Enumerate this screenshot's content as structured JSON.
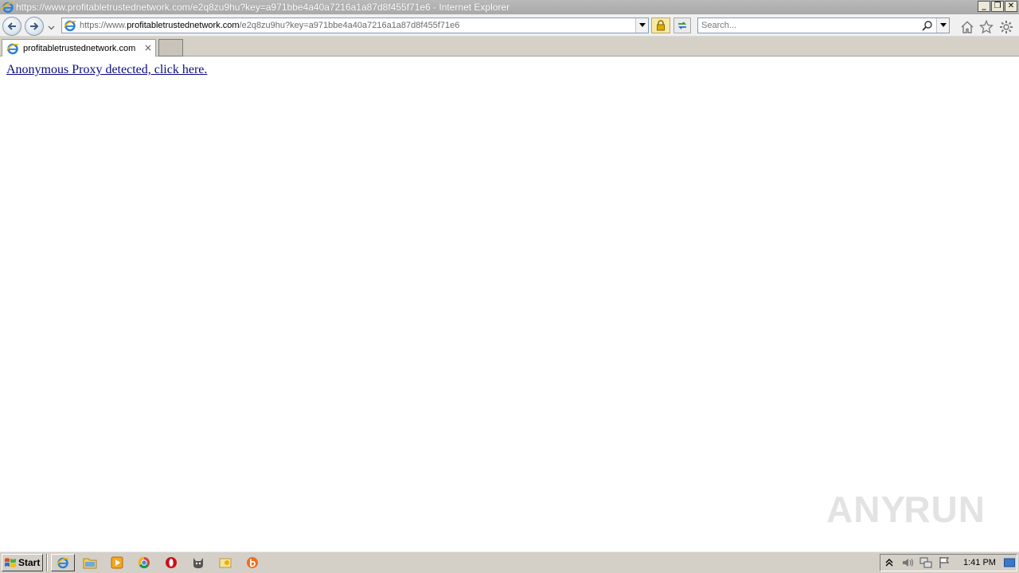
{
  "window": {
    "title": "https://www.profitabletrustednetwork.com/e2q8zu9hu?key=a971bbe4a40a7216a1a87d8f455f71e6 - Internet Explorer",
    "controls": {
      "minimize": "_",
      "restore": "❐",
      "close": "✕"
    }
  },
  "navbar": {
    "url_prefix": "https://www.",
    "url_domain": "profitabletrustednetwork.com",
    "url_path": "/e2q8zu9hu?key=a971bbe4a40a7216a1a87d8f455f71e6",
    "search_placeholder": "Search..."
  },
  "tabs": [
    {
      "label": "profitabletrustednetwork.com",
      "close": "×"
    }
  ],
  "content": {
    "link_text": "Anonymous Proxy detected, click here."
  },
  "watermark": {
    "left": "ANY",
    "right": "RUN"
  },
  "taskbar": {
    "start_label": "Start",
    "apps": [
      "internet-explorer",
      "file-explorer",
      "media-player",
      "chrome",
      "opera",
      "cat-app",
      "folder-app",
      "b-app"
    ],
    "clock": "1:41 PM"
  },
  "colors": {
    "link": "#0b0b80",
    "titlebar": "#b0b0b0",
    "taskbar": "#d4d0c8"
  }
}
